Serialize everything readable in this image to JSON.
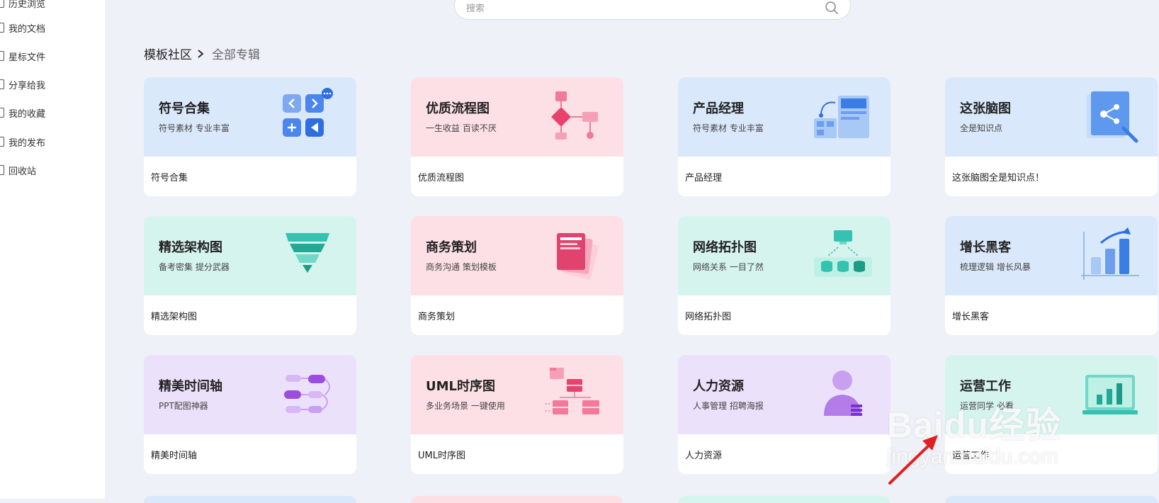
{
  "sidebar": {
    "items": [
      {
        "label": "历史浏览",
        "icon": "history-icon"
      },
      {
        "label": "我的文档",
        "icon": "document-icon"
      },
      {
        "label": "星标文件",
        "icon": "star-icon"
      },
      {
        "label": "分享给我",
        "icon": "share-icon"
      },
      {
        "label": "我的收藏",
        "icon": "favorite-icon"
      },
      {
        "label": "我的发布",
        "icon": "publish-icon"
      },
      {
        "label": "回收站",
        "icon": "trash-icon"
      }
    ]
  },
  "search": {
    "placeholder": "搜索",
    "icon": "search-icon"
  },
  "breadcrumb": {
    "root": "模板社区",
    "current": "全部专辑"
  },
  "cards": [
    {
      "title": "符号合集",
      "subtitle": "符号素材 专业丰富",
      "caption": "符号合集",
      "color": "#dae8fb",
      "icon": "symbol-grid-icon"
    },
    {
      "title": "优质流程图",
      "subtitle": "一生收益 百读不厌",
      "caption": "优质流程图",
      "color": "#fde0e6",
      "icon": "flowchart-icon"
    },
    {
      "title": "产品经理",
      "subtitle": "符号素材 专业丰富",
      "caption": "产品经理",
      "color": "#dae8fb",
      "icon": "product-layout-icon"
    },
    {
      "title": "这张脑图",
      "subtitle": "全是知识点",
      "caption": "这张脑图全是知识点！",
      "color": "#dae8fb",
      "icon": "mindmap-icon"
    },
    {
      "title": "精选架构图",
      "subtitle": "备考密集 提分武器",
      "caption": "精选架构图",
      "color": "#d6f4ee",
      "icon": "funnel-icon"
    },
    {
      "title": "商务策划",
      "subtitle": "商务沟通 策划模板",
      "caption": "商务策划",
      "color": "#fde0e6",
      "icon": "business-doc-icon"
    },
    {
      "title": "网络拓扑图",
      "subtitle": "网络关系 一目了然",
      "caption": "网络拓扑图",
      "color": "#d6f4ee",
      "icon": "network-topology-icon"
    },
    {
      "title": "增长黑客",
      "subtitle": "梳理逻辑 增长风暴",
      "caption": "增长黑客",
      "color": "#dae8fb",
      "icon": "growth-chart-icon"
    },
    {
      "title": "精美时间轴",
      "subtitle": "PPT配图神器",
      "caption": "精美时间轴",
      "color": "#ece1fb",
      "icon": "timeline-icon"
    },
    {
      "title": "UML时序图",
      "subtitle": "多业务场景 一键使用",
      "caption": "UML时序图",
      "color": "#fde0e6",
      "icon": "uml-icon"
    },
    {
      "title": "人力资源",
      "subtitle": "人事管理 招聘海报",
      "caption": "人力资源",
      "color": "#ece1fb",
      "icon": "hr-person-icon"
    },
    {
      "title": "运营工作",
      "subtitle": "运营同学 必看",
      "caption": "运营工作",
      "color": "#d6f4ee",
      "icon": "operations-chart-icon"
    }
  ],
  "watermark": {
    "logo": "Baidu经验",
    "url": "jingyan.baidu.com"
  },
  "colors": {
    "background": "#eef1f8",
    "blue_banner": "#dae8fb",
    "pink_banner": "#fde0e6",
    "mint_banner": "#d6f4ee",
    "purple_banner": "#ece1fb",
    "arrow": "#e02020"
  }
}
